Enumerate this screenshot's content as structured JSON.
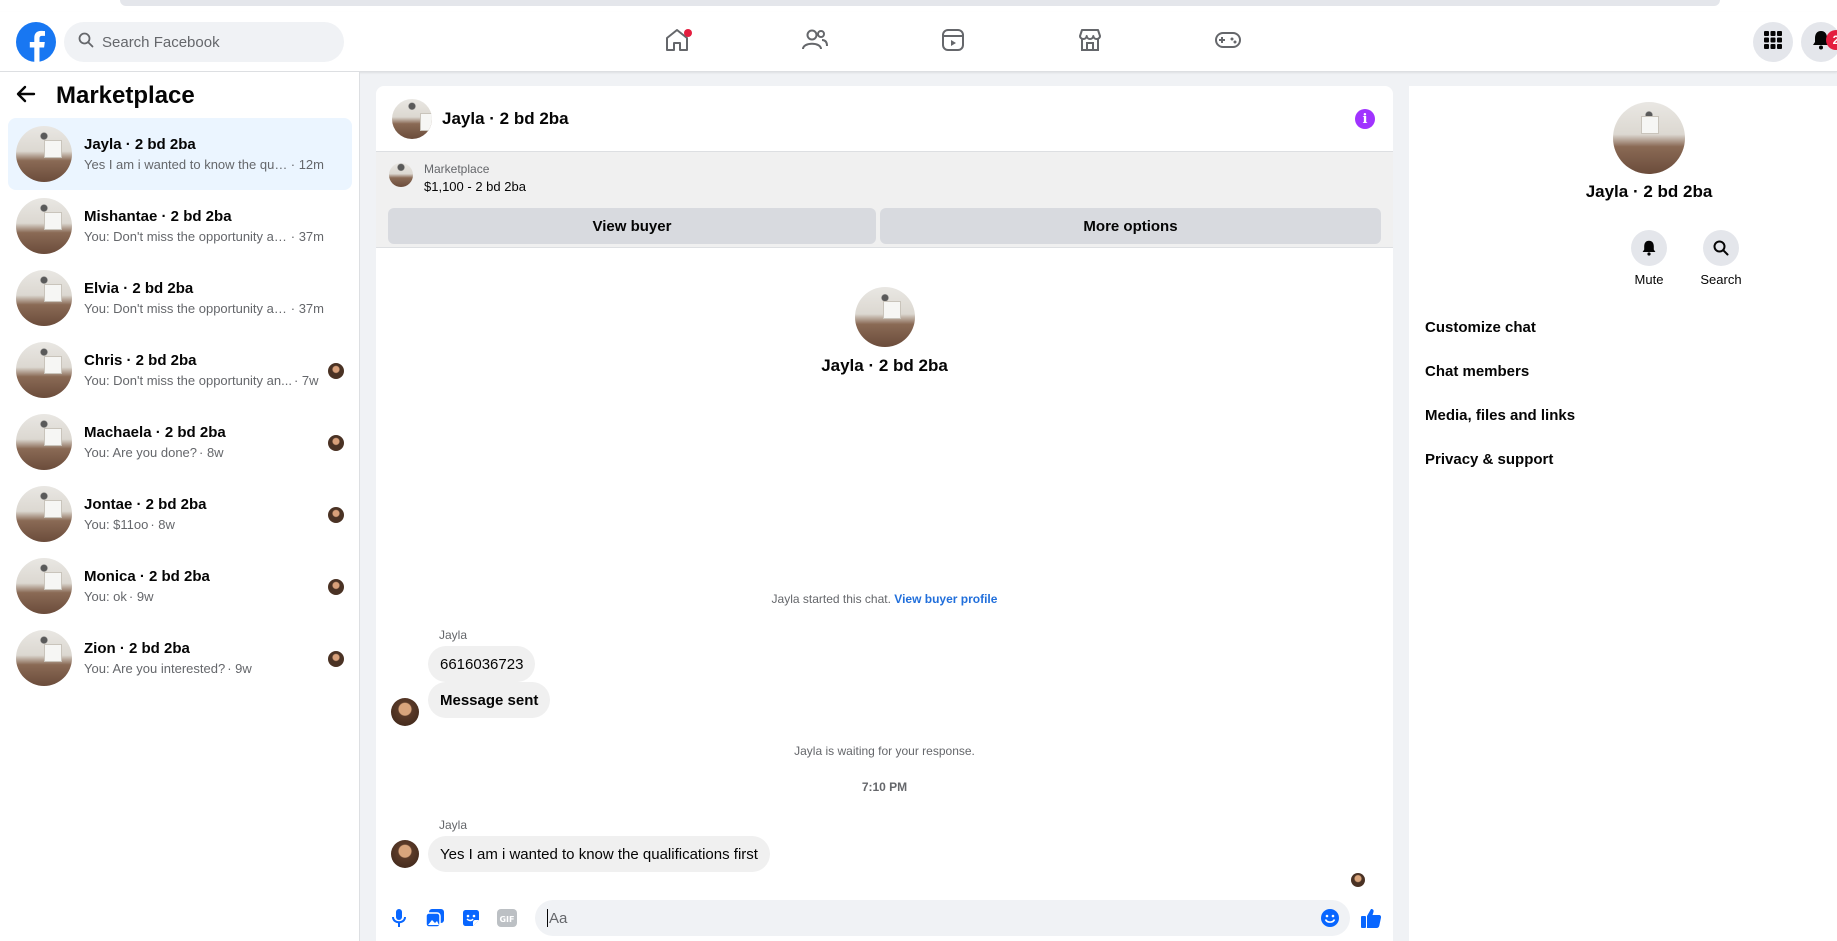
{
  "search": {
    "placeholder": "Search Facebook"
  },
  "nav": {
    "tabs": [
      "home-icon",
      "friends-icon",
      "watch-icon",
      "marketplace-icon",
      "gaming-icon"
    ],
    "notification_count": "2"
  },
  "sidebar": {
    "title": "Marketplace",
    "conversations": [
      {
        "name": "Jayla · 2 bd 2ba",
        "preview": "Yes I am i wanted to know the qualif...",
        "time": "· 12m",
        "active": true
      },
      {
        "name": "Mishantae · 2 bd 2ba",
        "preview": "You: Don't miss the opportunity and...",
        "time": "· 37m"
      },
      {
        "name": "Elvia · 2 bd 2ba",
        "preview": "You: Don't miss the opportunity and...",
        "time": "· 37m"
      },
      {
        "name": "Chris · 2 bd 2ba",
        "preview": "You: Don't miss the opportunity an...",
        "time": "· 7w"
      },
      {
        "name": "Machaela · 2 bd 2ba",
        "preview": "You: Are you done?",
        "time": "· 8w"
      },
      {
        "name": "Jontae · 2 bd 2ba",
        "preview": "You: $11oo",
        "time": "· 8w"
      },
      {
        "name": "Monica · 2 bd 2ba",
        "preview": "You: ok",
        "time": "· 9w"
      },
      {
        "name": "Zion · 2 bd 2ba",
        "preview": "You: Are you interested?",
        "time": "· 9w"
      }
    ]
  },
  "chat": {
    "title": "Jayla · 2 bd 2ba",
    "listing": {
      "label": "Marketplace",
      "price_title": "$1,100 - 2 bd 2ba",
      "view_buyer": "View buyer",
      "more_options": "More options"
    },
    "intro_name": "Jayla · 2 bd 2ba",
    "started_text": "Jayla started this chat.",
    "view_profile_link": "View buyer profile",
    "sender_1": "Jayla",
    "msg_1": "6616036723",
    "msg_2": "Message sent",
    "waiting_text": "Jayla is waiting for your response.",
    "timestamp": "7:10 PM",
    "sender_2": "Jayla",
    "msg_3": "Yes I am i wanted to know the qualifications first",
    "composer_placeholder": "Aa"
  },
  "info_panel": {
    "name": "Jayla · 2 bd 2ba",
    "mute_label": "Mute",
    "search_label": "Search",
    "items": [
      "Customize chat",
      "Chat members",
      "Media, files and links",
      "Privacy & support"
    ]
  },
  "colors": {
    "brand": "#1877f2",
    "active_bg": "#ebf5ff",
    "info_purple": "#a033ff",
    "link": "#216fdb"
  }
}
